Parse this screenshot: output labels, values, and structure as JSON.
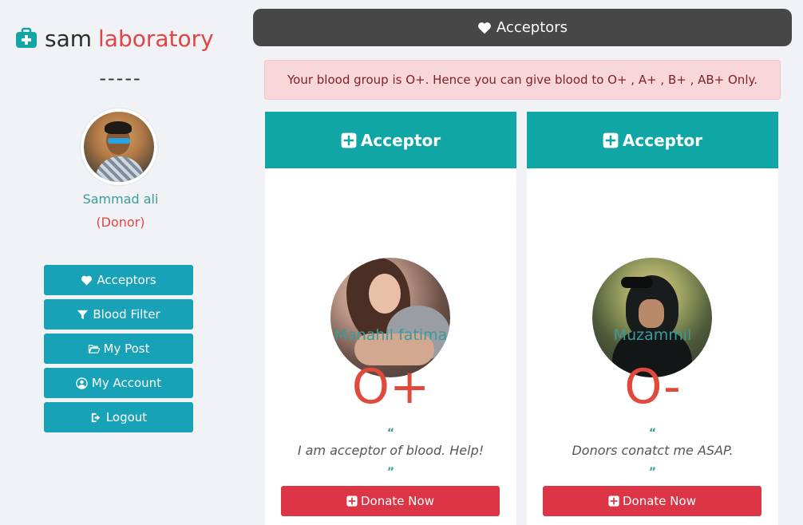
{
  "sidebar": {
    "logo_left": "sam",
    "logo_right": "laboratory",
    "divider": "-----",
    "user_name": "Sammad ali",
    "user_role": "(Donor)",
    "menu": [
      {
        "label": "Acceptors",
        "icon": "heartbeat-icon"
      },
      {
        "label": "Blood Filter",
        "icon": "filter-icon"
      },
      {
        "label": "My Post",
        "icon": "folder-open-icon"
      },
      {
        "label": "My Account",
        "icon": "user-circle-icon"
      },
      {
        "label": "Logout",
        "icon": "sign-out-icon"
      }
    ]
  },
  "header": {
    "title": "Acceptors"
  },
  "alert": {
    "text": "Your blood group is O+. Hence you can give blood to O+ , A+ , B+ , AB+ Only."
  },
  "cards": [
    {
      "header": "Acceptor",
      "name": "Manahil fatima",
      "blood_group": "O+",
      "quote_open": "“",
      "message": "I am acceptor of blood. Help!",
      "quote_close": "”",
      "button": "Donate Now"
    },
    {
      "header": "Acceptor",
      "name": "Muzammil",
      "blood_group": "O-",
      "quote_open": "“",
      "message": "Donors conatct me ASAP.",
      "quote_close": "”",
      "button": "Donate Now"
    }
  ],
  "colors": {
    "teal": "#17a2b8",
    "card_header": "#11a6a6",
    "red": "#dc3545",
    "blood_text": "#e04a3c",
    "topbar": "#474747",
    "alert_bg": "#f8d7da"
  }
}
